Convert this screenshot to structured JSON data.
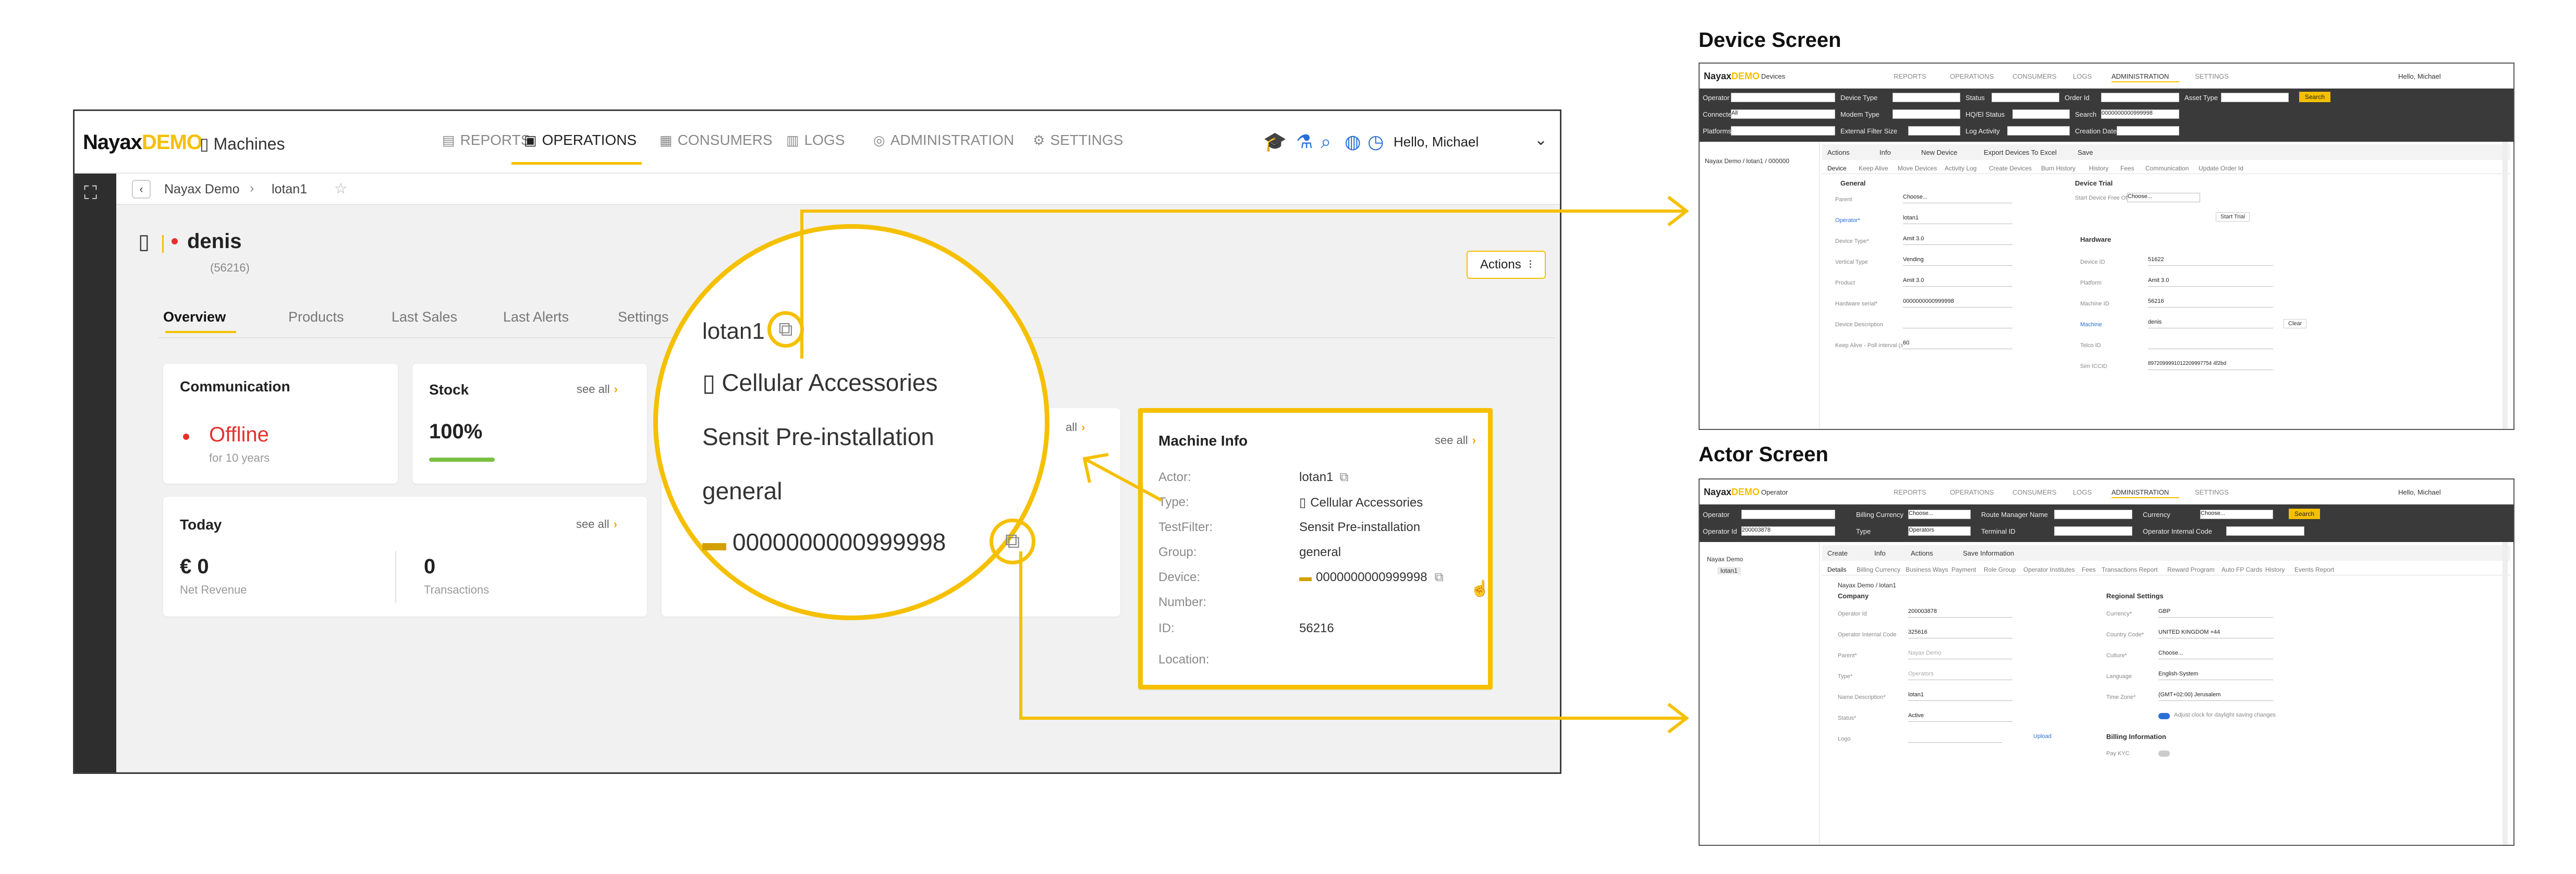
{
  "app": {
    "brand_a": "Nayax",
    "brand_b": "DEMO",
    "page_title": "Machines",
    "nav": [
      {
        "label": "REPORTS",
        "icon": "reports-icon"
      },
      {
        "label": "OPERATIONS",
        "icon": "operations-icon"
      },
      {
        "label": "CONSUMERS",
        "icon": "consumers-icon"
      },
      {
        "label": "LOGS",
        "icon": "logs-icon"
      },
      {
        "label": "ADMINISTRATION",
        "icon": "administration-icon"
      },
      {
        "label": "SETTINGS",
        "icon": "settings-icon"
      }
    ],
    "greeting": "Hello, Michael",
    "breadcrumb": [
      "Nayax Demo",
      "lotan1"
    ],
    "machine_name": "denis",
    "machine_id": "(56216)",
    "actions_label": "Actions",
    "tabs": [
      "Overview",
      "Products",
      "Last Sales",
      "Last Alerts",
      "Settings"
    ],
    "communication": {
      "title": "Communication",
      "status": "Offline",
      "sub": "for 10 years"
    },
    "stock": {
      "title": "Stock",
      "see_all": "see all",
      "value": "100%",
      "fill": 1.0
    },
    "today": {
      "title": "Today",
      "see_all": "see all",
      "revenue": "€ 0",
      "revenue_label": "Net Revenue",
      "transactions": "0",
      "transactions_label": "Transactions"
    },
    "partial_see_all": "all",
    "machine_info": {
      "title": "Machine Info",
      "see_all": "see all",
      "rows": [
        {
          "label": "Actor:",
          "value": "lotan1"
        },
        {
          "label": "Type:",
          "value": "Cellular Accessories"
        },
        {
          "label": "TestFilter:",
          "value": "Sensit Pre-installation"
        },
        {
          "label": "Group:",
          "value": "general"
        },
        {
          "label": "Device:",
          "value": "0000000000999998"
        },
        {
          "label": "Number:",
          "value": ""
        },
        {
          "label": "ID:",
          "value": "56216"
        },
        {
          "label": "Location:",
          "value": ""
        }
      ]
    }
  },
  "zoom": {
    "actor": "lotan1",
    "type": "Cellular Accessories",
    "filter": "Sensit Pre-installation",
    "group": "general",
    "device": "0000000000999998"
  },
  "device_screen": {
    "heading": "Device Screen",
    "brand_a": "Nayax",
    "brand_b": "DEMO",
    "page": "Devices",
    "nav": [
      "REPORTS",
      "OPERATIONS",
      "CONSUMERS",
      "LOGS",
      "ADMINISTRATION",
      "SETTINGS"
    ],
    "greeting": "Hello, Michael",
    "filters": [
      "Operator",
      "Device Type",
      "Status",
      "Order Id",
      "Asset Type",
      "Connected",
      "Modem Type",
      "HQ/El Status",
      "Search",
      "Platforms",
      "External Filter Size",
      "Log Activity",
      "Creation Date"
    ],
    "search_btn": "Search",
    "select_all": "All",
    "choose": "Choose...",
    "search_value": "0000000000999998",
    "tree_item": "Nayax Demo / lotan1 / 000000",
    "toolbar": [
      "Actions",
      "Info",
      "New Device",
      "Export Devices To Excel",
      "Save"
    ],
    "tabs": [
      "Device",
      "Keep Alive",
      "Move Devices",
      "Activity Log",
      "Create Devices",
      "Burn History",
      "History",
      "Fees",
      "Communication",
      "Update Order Id"
    ],
    "general_title": "General",
    "device_trial_title": "Device Trial",
    "hardware_title": "Hardware",
    "start_trial_label": "Start Device Free Of",
    "start_trial_btn": "Start Trial",
    "clear_btn": "Clear",
    "left_fields": [
      {
        "label": "Parent",
        "value": "Choose..."
      },
      {
        "label": "Operator*",
        "value": "lotan1"
      },
      {
        "label": "Device Type*",
        "value": "Amit 3.0"
      },
      {
        "label": "Vertical Type",
        "value": "Vending"
      },
      {
        "label": "Product",
        "value": "Amit 3.0"
      },
      {
        "label": "Hardware serial*",
        "value": "0000000000999998"
      },
      {
        "label": "Device Description",
        "value": ""
      },
      {
        "label": "Keep Alive - Poll interval (sec)",
        "value": "60"
      }
    ],
    "right_fields": [
      {
        "label": "Device ID",
        "value": "51622"
      },
      {
        "label": "Platform",
        "value": "Amit 3.0"
      },
      {
        "label": "Machine ID",
        "value": "56216"
      },
      {
        "label": "Machine",
        "value": "denis"
      },
      {
        "label": "Telco ID",
        "value": ""
      },
      {
        "label": "Sim ICCID",
        "value": "8972099991012209997754 4f2bd"
      }
    ]
  },
  "actor_screen": {
    "heading": "Actor Screen",
    "brand_a": "Nayax",
    "brand_b": "DEMO",
    "page": "Operator",
    "nav": [
      "REPORTS",
      "OPERATIONS",
      "CONSUMERS",
      "LOGS",
      "ADMINISTRATION",
      "SETTINGS"
    ],
    "greeting": "Hello, Michael",
    "filters": [
      "Operator",
      "Billing Currency",
      "Route Manager Name",
      "Currency",
      "Operator Id",
      "Type",
      "Terminal ID",
      "Operator Internal Code"
    ],
    "operator_id_value": "200003878",
    "type_value": "Operators",
    "choose": "Choose...",
    "search_btn": "Search",
    "tree": [
      "Nayax Demo",
      "lotan1"
    ],
    "toolbar": [
      "Create",
      "Info",
      "Actions",
      "Save Information"
    ],
    "tabs": [
      "Details",
      "Billing Currency",
      "Business Ways",
      "Payment",
      "Role Group",
      "Operator Institutes",
      "Fees",
      "Transactions Report",
      "Reward Program",
      "Auto FP Cards",
      "History",
      "Events Report"
    ],
    "path": "Nayax Demo / lotan1",
    "company_title": "Company",
    "regional_title": "Regional Settings",
    "billing_title": "Billing Information",
    "left_fields": [
      {
        "label": "Operator Id",
        "value": "200003878"
      },
      {
        "label": "Operator Internal Code",
        "value": "325616"
      },
      {
        "label": "Parent*",
        "value": "Nayax Demo"
      },
      {
        "label": "Type*",
        "value": "Operators"
      },
      {
        "label": "Name Description*",
        "value": "lotan1"
      },
      {
        "label": "Status*",
        "value": "Active"
      },
      {
        "label": "Logo",
        "value": ""
      }
    ],
    "upload_btn": "Upload",
    "right_fields": [
      {
        "label": "Currency*",
        "value": "GBP"
      },
      {
        "label": "Country Code*",
        "value": "UNITED KINGDOM +44"
      },
      {
        "label": "Culture*",
        "value": "Choose..."
      },
      {
        "label": "Language",
        "value": "English-System"
      },
      {
        "label": "Time Zone*",
        "value": "(GMT+02:00) Jerusalem"
      }
    ],
    "dst_label": "Adjust clock for daylight saving changes",
    "pay_label": "Pay KYC"
  },
  "colors": {
    "accent": "#f5c000",
    "offline": "#e5312e",
    "dark_bar": "#3a3a3a",
    "sidebar": "#2e2e2e"
  }
}
